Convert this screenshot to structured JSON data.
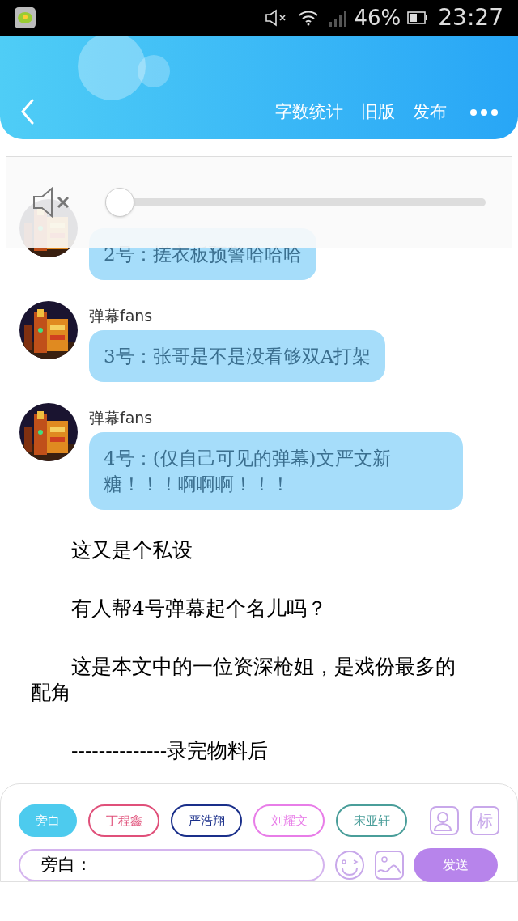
{
  "status_bar": {
    "battery": "46%",
    "time": "23:27"
  },
  "header": {
    "actions": [
      "字数统计",
      "旧版",
      "发布"
    ]
  },
  "volume_overlay": {
    "muted": true,
    "level": 0
  },
  "messages": [
    {
      "text": "2号：搓衣板预警哈哈哈"
    },
    {
      "name": "弹幕fans",
      "text": "3号：张哥是不是没看够双A打架"
    },
    {
      "name": "弹幕fans",
      "text": "4号：(仅自己可见的弹幕)文严文新糖！！！啊啊啊！！！"
    }
  ],
  "paragraphs": [
    "这又是个私设",
    "有人帮4号弹幕起个名儿吗？",
    "这是本文中的一位资深枪姐，是戏份最多的配角",
    "--------------录完物料后"
  ],
  "roles": [
    {
      "label": "旁白",
      "color": "#4dcbee",
      "selected": true
    },
    {
      "label": "丁程鑫",
      "color": "#e0507a",
      "selected": false
    },
    {
      "label": "严浩翔",
      "color": "#1a2f8a",
      "selected": false
    },
    {
      "label": "刘耀文",
      "color": "#e87de8",
      "selected": false
    },
    {
      "label": "宋亚轩",
      "color": "#4a9e9a",
      "selected": false
    }
  ],
  "side_tag": "标",
  "input": {
    "value": "旁白："
  },
  "send_button": "发送"
}
